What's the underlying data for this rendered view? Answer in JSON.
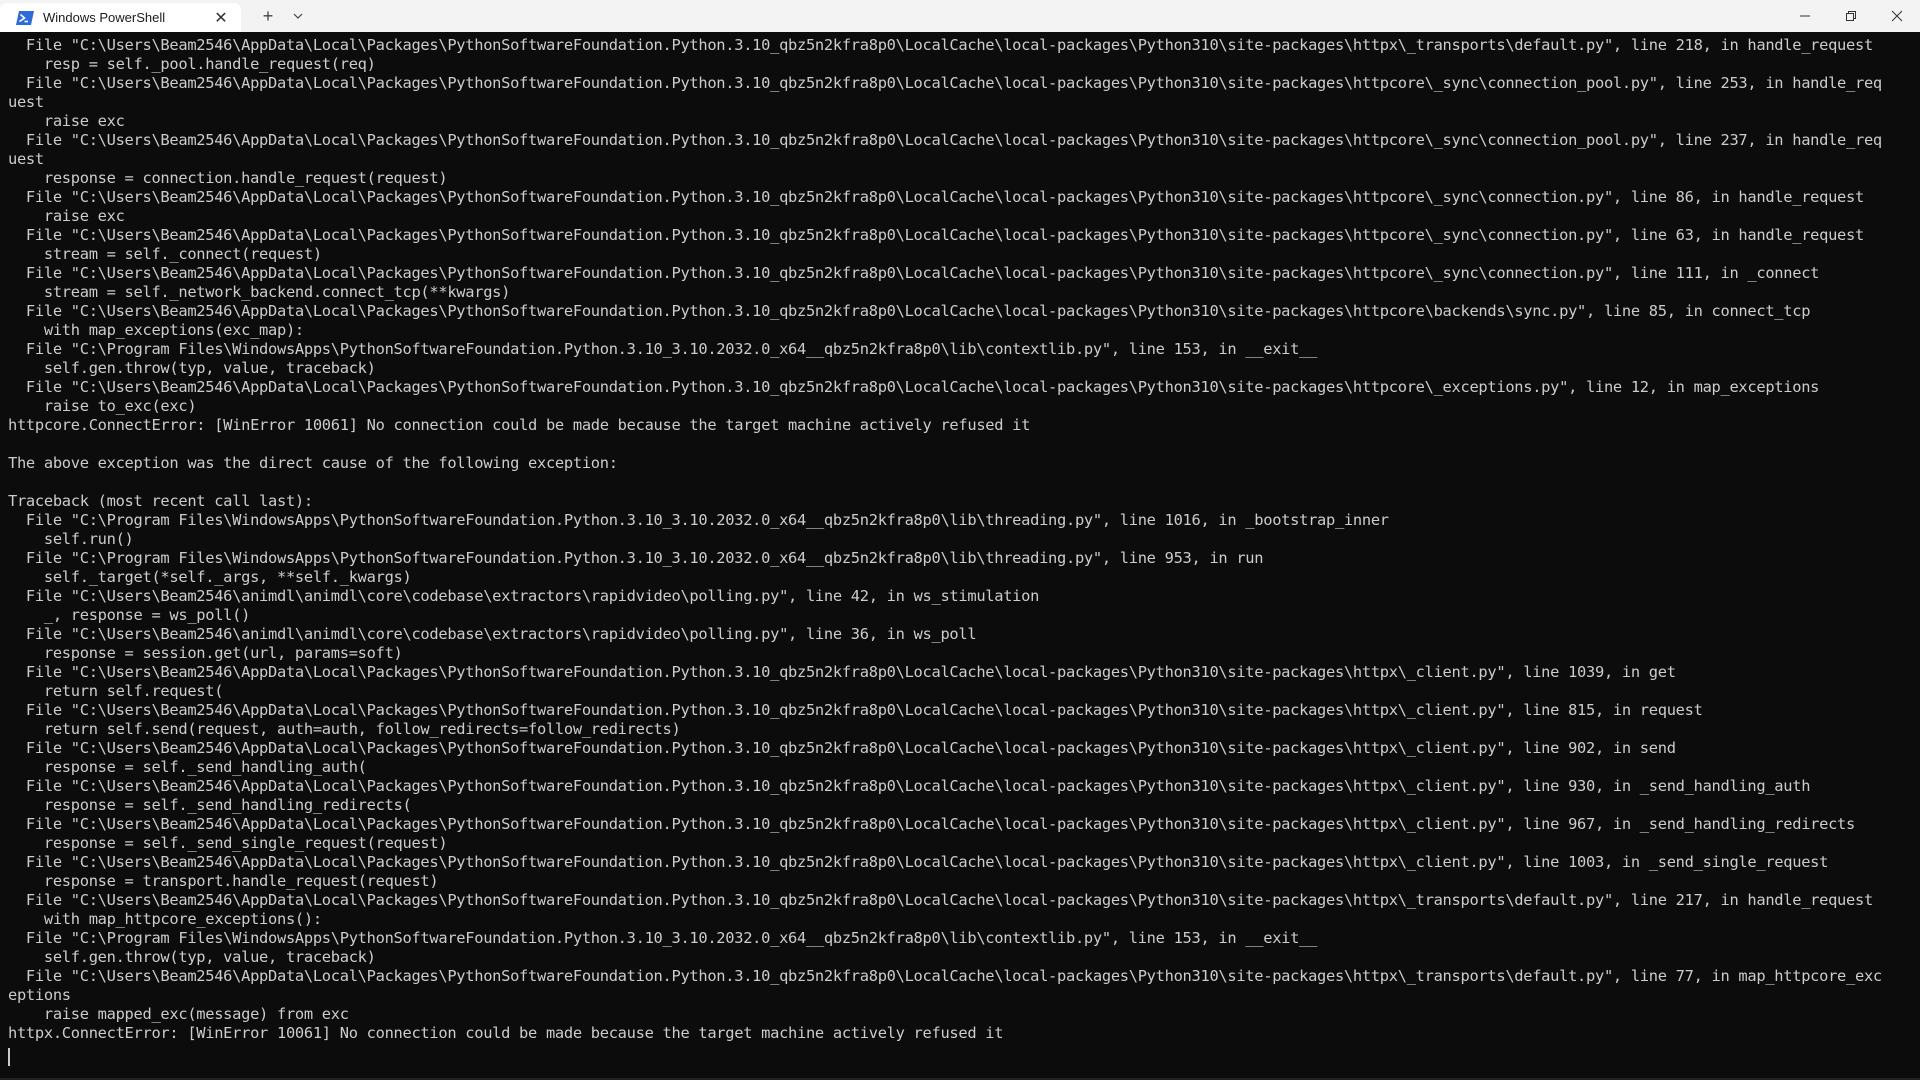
{
  "window": {
    "tab_title": "Windows PowerShell",
    "tab_icon": "powershell-icon",
    "new_tab_symbol": "+",
    "dropdown_symbol": "⌄",
    "close_tab_symbol": "✕"
  },
  "colors": {
    "terminal_background": "#0c0c0c",
    "terminal_text": "#cccccc",
    "titlebar_background": "#f3f3f3",
    "powershell_icon": "#2d6bd8"
  },
  "terminal": {
    "text": "  File \"C:\\Users\\Beam2546\\AppData\\Local\\Packages\\PythonSoftwareFoundation.Python.3.10_qbz5n2kfra8p0\\LocalCache\\local-packages\\Python310\\site-packages\\httpx\\_transports\\default.py\", line 218, in handle_request\n    resp = self._pool.handle_request(req)\n  File \"C:\\Users\\Beam2546\\AppData\\Local\\Packages\\PythonSoftwareFoundation.Python.3.10_qbz5n2kfra8p0\\LocalCache\\local-packages\\Python310\\site-packages\\httpcore\\_sync\\connection_pool.py\", line 253, in handle_req\nuest\n    raise exc\n  File \"C:\\Users\\Beam2546\\AppData\\Local\\Packages\\PythonSoftwareFoundation.Python.3.10_qbz5n2kfra8p0\\LocalCache\\local-packages\\Python310\\site-packages\\httpcore\\_sync\\connection_pool.py\", line 237, in handle_req\nuest\n    response = connection.handle_request(request)\n  File \"C:\\Users\\Beam2546\\AppData\\Local\\Packages\\PythonSoftwareFoundation.Python.3.10_qbz5n2kfra8p0\\LocalCache\\local-packages\\Python310\\site-packages\\httpcore\\_sync\\connection.py\", line 86, in handle_request\n    raise exc\n  File \"C:\\Users\\Beam2546\\AppData\\Local\\Packages\\PythonSoftwareFoundation.Python.3.10_qbz5n2kfra8p0\\LocalCache\\local-packages\\Python310\\site-packages\\httpcore\\_sync\\connection.py\", line 63, in handle_request\n    stream = self._connect(request)\n  File \"C:\\Users\\Beam2546\\AppData\\Local\\Packages\\PythonSoftwareFoundation.Python.3.10_qbz5n2kfra8p0\\LocalCache\\local-packages\\Python310\\site-packages\\httpcore\\_sync\\connection.py\", line 111, in _connect\n    stream = self._network_backend.connect_tcp(**kwargs)\n  File \"C:\\Users\\Beam2546\\AppData\\Local\\Packages\\PythonSoftwareFoundation.Python.3.10_qbz5n2kfra8p0\\LocalCache\\local-packages\\Python310\\site-packages\\httpcore\\backends\\sync.py\", line 85, in connect_tcp\n    with map_exceptions(exc_map):\n  File \"C:\\Program Files\\WindowsApps\\PythonSoftwareFoundation.Python.3.10_3.10.2032.0_x64__qbz5n2kfra8p0\\lib\\contextlib.py\", line 153, in __exit__\n    self.gen.throw(typ, value, traceback)\n  File \"C:\\Users\\Beam2546\\AppData\\Local\\Packages\\PythonSoftwareFoundation.Python.3.10_qbz5n2kfra8p0\\LocalCache\\local-packages\\Python310\\site-packages\\httpcore\\_exceptions.py\", line 12, in map_exceptions\n    raise to_exc(exc)\nhttpcore.ConnectError: [WinError 10061] No connection could be made because the target machine actively refused it\n\nThe above exception was the direct cause of the following exception:\n\nTraceback (most recent call last):\n  File \"C:\\Program Files\\WindowsApps\\PythonSoftwareFoundation.Python.3.10_3.10.2032.0_x64__qbz5n2kfra8p0\\lib\\threading.py\", line 1016, in _bootstrap_inner\n    self.run()\n  File \"C:\\Program Files\\WindowsApps\\PythonSoftwareFoundation.Python.3.10_3.10.2032.0_x64__qbz5n2kfra8p0\\lib\\threading.py\", line 953, in run\n    self._target(*self._args, **self._kwargs)\n  File \"C:\\Users\\Beam2546\\animdl\\animdl\\core\\codebase\\extractors\\rapidvideo\\polling.py\", line 42, in ws_stimulation\n    _, response = ws_poll()\n  File \"C:\\Users\\Beam2546\\animdl\\animdl\\core\\codebase\\extractors\\rapidvideo\\polling.py\", line 36, in ws_poll\n    response = session.get(url, params=soft)\n  File \"C:\\Users\\Beam2546\\AppData\\Local\\Packages\\PythonSoftwareFoundation.Python.3.10_qbz5n2kfra8p0\\LocalCache\\local-packages\\Python310\\site-packages\\httpx\\_client.py\", line 1039, in get\n    return self.request(\n  File \"C:\\Users\\Beam2546\\AppData\\Local\\Packages\\PythonSoftwareFoundation.Python.3.10_qbz5n2kfra8p0\\LocalCache\\local-packages\\Python310\\site-packages\\httpx\\_client.py\", line 815, in request\n    return self.send(request, auth=auth, follow_redirects=follow_redirects)\n  File \"C:\\Users\\Beam2546\\AppData\\Local\\Packages\\PythonSoftwareFoundation.Python.3.10_qbz5n2kfra8p0\\LocalCache\\local-packages\\Python310\\site-packages\\httpx\\_client.py\", line 902, in send\n    response = self._send_handling_auth(\n  File \"C:\\Users\\Beam2546\\AppData\\Local\\Packages\\PythonSoftwareFoundation.Python.3.10_qbz5n2kfra8p0\\LocalCache\\local-packages\\Python310\\site-packages\\httpx\\_client.py\", line 930, in _send_handling_auth\n    response = self._send_handling_redirects(\n  File \"C:\\Users\\Beam2546\\AppData\\Local\\Packages\\PythonSoftwareFoundation.Python.3.10_qbz5n2kfra8p0\\LocalCache\\local-packages\\Python310\\site-packages\\httpx\\_client.py\", line 967, in _send_handling_redirects\n    response = self._send_single_request(request)\n  File \"C:\\Users\\Beam2546\\AppData\\Local\\Packages\\PythonSoftwareFoundation.Python.3.10_qbz5n2kfra8p0\\LocalCache\\local-packages\\Python310\\site-packages\\httpx\\_client.py\", line 1003, in _send_single_request\n    response = transport.handle_request(request)\n  File \"C:\\Users\\Beam2546\\AppData\\Local\\Packages\\PythonSoftwareFoundation.Python.3.10_qbz5n2kfra8p0\\LocalCache\\local-packages\\Python310\\site-packages\\httpx\\_transports\\default.py\", line 217, in handle_request\n    with map_httpcore_exceptions():\n  File \"C:\\Program Files\\WindowsApps\\PythonSoftwareFoundation.Python.3.10_3.10.2032.0_x64__qbz5n2kfra8p0\\lib\\contextlib.py\", line 153, in __exit__\n    self.gen.throw(typ, value, traceback)\n  File \"C:\\Users\\Beam2546\\AppData\\Local\\Packages\\PythonSoftwareFoundation.Python.3.10_qbz5n2kfra8p0\\LocalCache\\local-packages\\Python310\\site-packages\\httpx\\_transports\\default.py\", line 77, in map_httpcore_exc\neptions\n    raise mapped_exc(message) from exc\nhttpx.ConnectError: [WinError 10061] No connection could be made because the target machine actively refused it"
  }
}
